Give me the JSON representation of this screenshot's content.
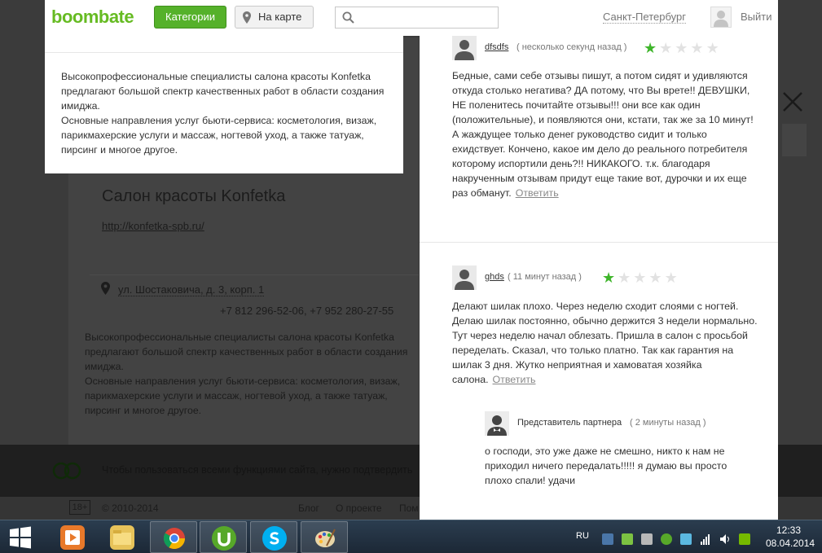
{
  "header": {
    "logo": "boombate",
    "categories_label": "Категории",
    "map_label": "На карте",
    "search_placeholder": "",
    "city": "Санкт-Петербург",
    "logout_label": "Выйти"
  },
  "salon": {
    "title": "Салон красоты Konfetka",
    "site": "http://konfetka-spb.ru/",
    "address": "ул. Шостаковича, д. 3, корп. 1",
    "phones": "+7 812 296-52-06, +7 952 280-27-55",
    "description": "Высокопрофессиональные специалисты салона красоты Konfetka предлагают большой спектр качественных работ в области создания имиджа.\nОсновные направления услуг бьюти-сервиса: косметология, визаж, парикмахерские услуги и массаж, ногтевой уход, а также татуаж, пирсинг и многое другое."
  },
  "banner": {
    "text": "Чтобы пользоваться всеми функциями сайта, нужно подтвердить"
  },
  "footer": {
    "age": "18+",
    "copyright": "© 2010-2014",
    "links": [
      "Блог",
      "О проекте",
      "Пом"
    ]
  },
  "reviews": [
    {
      "author": "dfsdfs",
      "time": "( несколько секунд назад )",
      "rating": 1,
      "text": "Бедные, сами себе отзывы пишут, а потом сидят и удивляются откуда столько негатива? ДА потому, что Вы врете!! ДЕВУШКИ, НЕ поленитесь почитайте отзывы!!! они все как один (положительные), и появляются они, кстати, так же за 10 минут! А жаждущее только денег руководство сидит и только ехидствует. Кончено, какое им дело до реального потребителя которому испортили день?!! НИКАКОГО. т.к. благодаря накрученным отзывам придут еще такие вот, дурочки и их еще раз обманут.",
      "reply_label": "Ответить"
    },
    {
      "author": "ghds",
      "time": "( 11 минут назад )",
      "rating": 1,
      "text": "Делают шилак плохо. Через неделю сходит слоями с ногтей. Делаю шилак постоянно, обычно держится 3 недели нормально. Тут через неделю начал облезать. Пришла в салон с просьбой переделать. Сказал, что только платно. Так как гарантия на шилак 3 дня. Жутко неприятная и хамоватая хозяйка салона.",
      "reply_label": "Ответить"
    }
  ],
  "partner_reply": {
    "author": "Представитель партнера",
    "time": "( 2 минуты назад )",
    "text": "о господи, это уже даже не смешно, никто к нам не приходил ничего передалать!!!!! я думаю вы просто плохо спали! удачи"
  },
  "taskbar": {
    "language": "RU",
    "time": "12:33",
    "date": "08.04.2014",
    "apps": [
      "media-player",
      "file-explorer",
      "chrome",
      "utorrent",
      "skype",
      "paint"
    ]
  },
  "colors": {
    "accent_green": "#55b12a",
    "star_green": "#3fb52b",
    "overlay": "#3b3b3b"
  }
}
